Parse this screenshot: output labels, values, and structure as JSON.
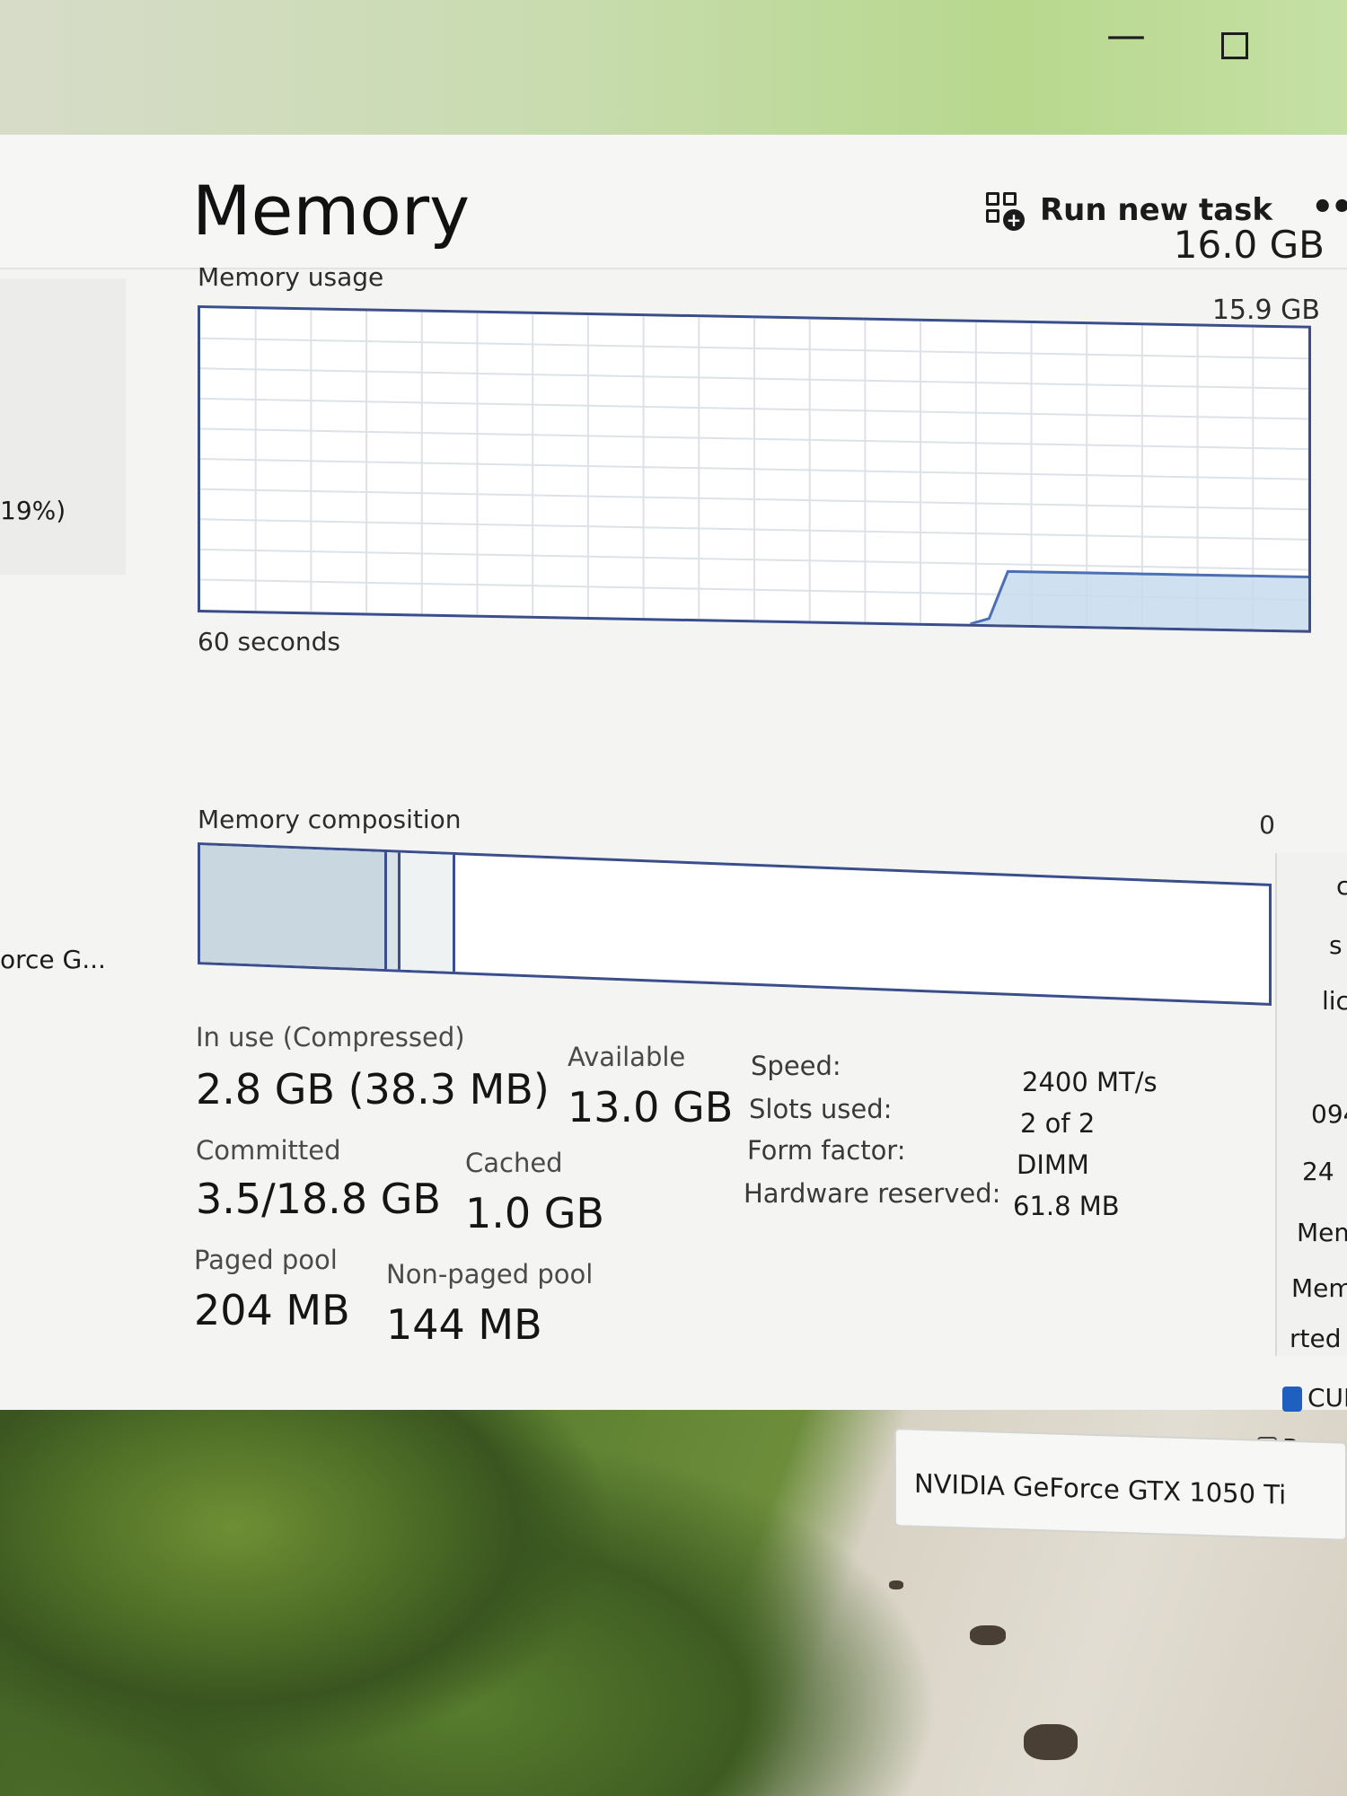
{
  "window_controls": {
    "minimize": "—"
  },
  "toolbar": {
    "run_new_task": "Run new task",
    "more": "••"
  },
  "left_nav": {
    "fragment_percent": "19%)",
    "fragment_gpu": "orce G...",
    "fragment_paren": ")"
  },
  "memory": {
    "title": "Memory",
    "total_capacity": "16.0 GB",
    "usage_label": "Memory usage",
    "usage_max": "15.9 GB",
    "time_label": "60 seconds",
    "zero_label": "0",
    "composition_label": "Memory composition"
  },
  "stats": {
    "in_use_label": "In use (Compressed)",
    "in_use_value": "2.8 GB (38.3 MB)",
    "available_label": "Available",
    "available_value": "13.0 GB",
    "committed_label": "Committed",
    "committed_value": "3.5/18.8 GB",
    "cached_label": "Cached",
    "cached_value": "1.0 GB",
    "paged_pool_label": "Paged pool",
    "paged_pool_value": "204 MB",
    "nonpaged_pool_label": "Non-paged pool",
    "nonpaged_pool_value": "144 MB"
  },
  "specs": {
    "speed_label": "Speed:",
    "speed_value": "2400 MT/s",
    "slots_label": "Slots used:",
    "slots_value": "2 of 2",
    "form_label": "Form factor:",
    "form_value": "DIMM",
    "reserved_label": "Hardware reserved:",
    "reserved_value": "61.8 MB"
  },
  "right_fragments": [
    "c",
    "s",
    "lic",
    "094",
    "24",
    "Mem",
    "Memc",
    "rted",
    "CUD",
    "Ray"
  ],
  "gpu_popup": {
    "name": "NVIDIA GeForce GTX 1050 Ti"
  },
  "usage_history": {
    "max_gb": 15.9,
    "points_gb": [
      0,
      0,
      0,
      0,
      0,
      0,
      0,
      0,
      0,
      0,
      0,
      0,
      0,
      0,
      0,
      0,
      0,
      0,
      0,
      0,
      0,
      0,
      0,
      0,
      0,
      0,
      0,
      0,
      0,
      0,
      0,
      0,
      0,
      0,
      0,
      0,
      0,
      0,
      0,
      0,
      0,
      0,
      0.3,
      2.8,
      2.8,
      2.8,
      2.8,
      2.8,
      2.8,
      2.8,
      2.8,
      2.8,
      2.8,
      2.8,
      2.8,
      2.8,
      2.8,
      2.8,
      2.8,
      2.8
    ]
  },
  "composition": {
    "in_use_fraction": 0.175,
    "modified_fraction": 0.012,
    "standby_fraction": 0.052
  },
  "colors": {
    "graph_border": "#3b4e8c",
    "graph_fill": "#c7dbef",
    "graph_line": "#4a6fb3",
    "grid": "#dde2e8"
  }
}
